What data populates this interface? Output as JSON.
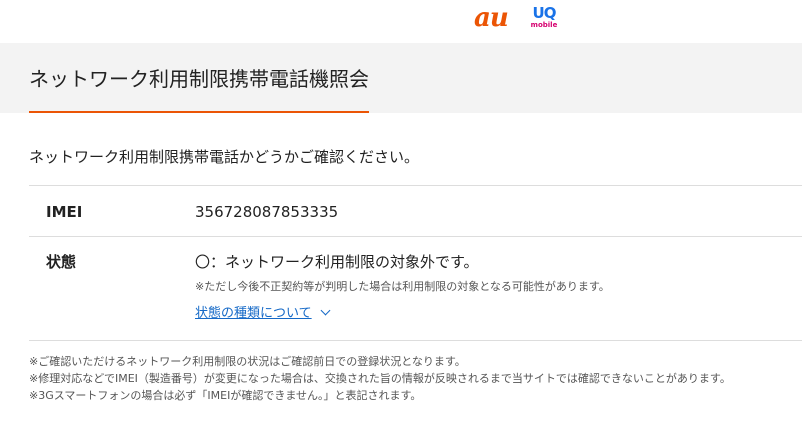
{
  "logos": {
    "au": "au",
    "uq": "UQ",
    "uq_sub": "mobile"
  },
  "header": {
    "title": "ネットワーク利用制限携帯電話機照会"
  },
  "main": {
    "lead": "ネットワーク利用制限携帯電話かどうかご確認ください。",
    "imei": {
      "label": "IMEI",
      "value": "356728087853335"
    },
    "status": {
      "label": "状態",
      "value": "〇：ネットワーク利用制限の対象外です。",
      "note": "※ただし今後不正契約等が判明した場合は利用制限の対象となる可能性があります。",
      "link": "状態の種類について"
    },
    "notes": [
      "※ご確認いただけるネットワーク利用制限の状況はご確認前日での登録状況となります。",
      "※修理対応などでIMEI（製造番号）が変更になった場合は、交換された旨の情報が反映されるまで当サイトでは確認できないことがあります。",
      "※3Gスマートフォンの場合は必ず「IMEIが確認できません。」と表記されます。"
    ]
  },
  "colors": {
    "accent": "#eb5505",
    "link": "#1569c7",
    "header_bg": "#f3f3f3"
  }
}
